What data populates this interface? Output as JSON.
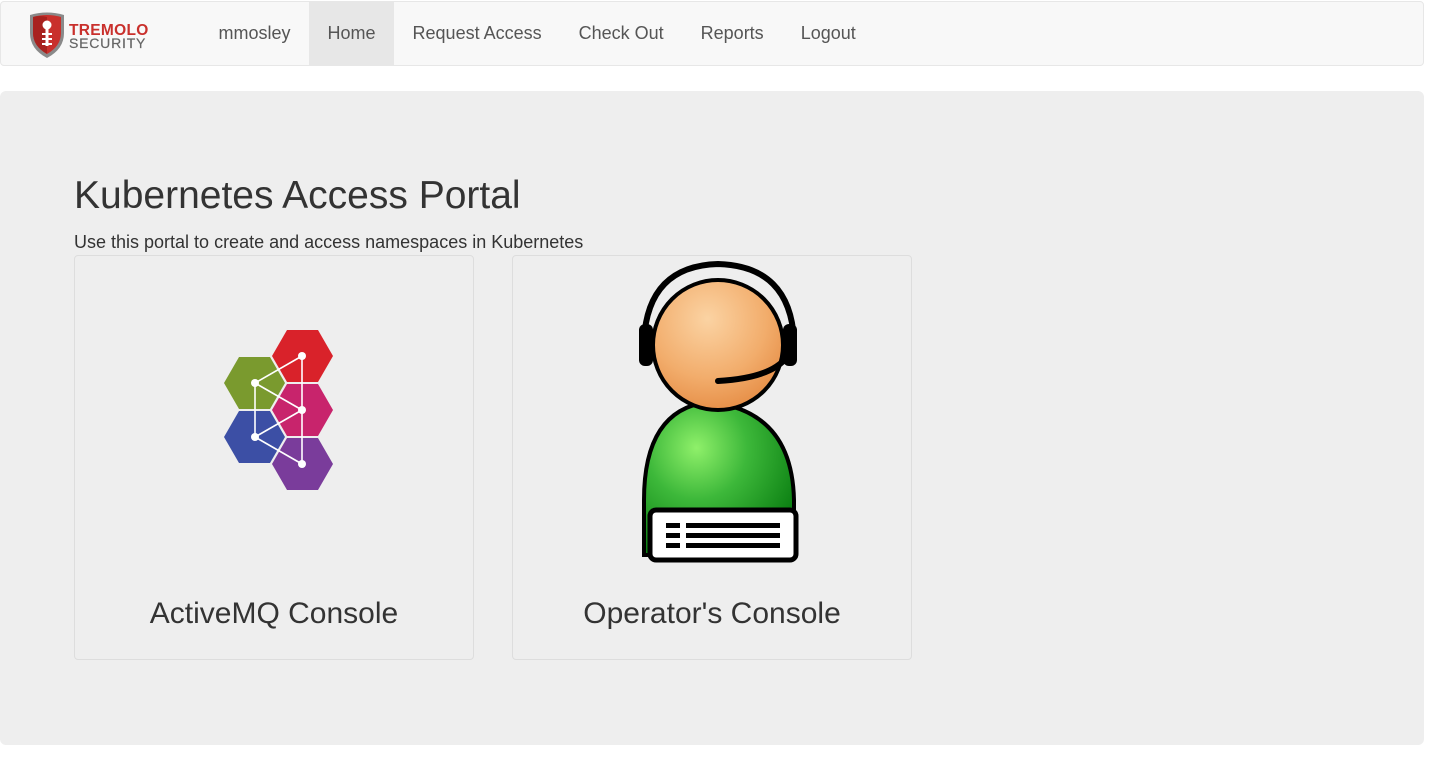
{
  "navbar": {
    "brand": {
      "line1": "TREMOLO",
      "line2": "SECURITY"
    },
    "items": [
      {
        "label": "mmosley",
        "active": false
      },
      {
        "label": "Home",
        "active": true
      },
      {
        "label": "Request Access",
        "active": false
      },
      {
        "label": "Check Out",
        "active": false
      },
      {
        "label": "Reports",
        "active": false
      },
      {
        "label": "Logout",
        "active": false
      }
    ]
  },
  "main": {
    "title": "Kubernetes Access Portal",
    "subtitle": "Use this portal to create and access namespaces in Kubernetes",
    "tiles": [
      {
        "label": "ActiveMQ Console",
        "icon": "activemq-hexagon-icon"
      },
      {
        "label": "Operator's Console",
        "icon": "operator-headset-icon"
      }
    ]
  },
  "colors": {
    "navbar_bg": "#f8f8f8",
    "nav_active_bg": "#e7e7e7",
    "jumbotron_bg": "#eeeeee",
    "brand_red": "#c9302c",
    "hex_red": "#d9222a",
    "hex_green": "#7a9a2e",
    "hex_pink": "#c8246c",
    "hex_blue": "#3c4fa5",
    "hex_purple": "#7a3c9b",
    "operator_body": "#2fa82f",
    "operator_face": "#f0a66a"
  }
}
